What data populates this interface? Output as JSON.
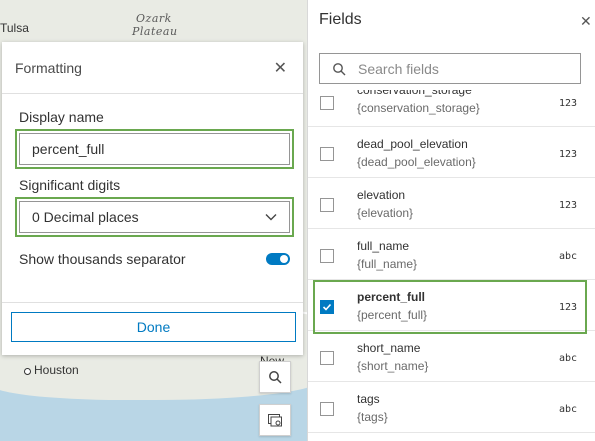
{
  "map": {
    "labels": {
      "tulsa": "Tulsa",
      "ozark": "Ozark",
      "plateau": "Plateau",
      "houston": "Houston",
      "new_orleans": "New Orle"
    }
  },
  "formatting": {
    "title": "Formatting",
    "display_name_label": "Display name",
    "display_name_value": "percent_full",
    "sig_digits_label": "Significant digits",
    "sig_digits_value": "0 Decimal places",
    "thousands_label": "Show thousands separator",
    "thousands_enabled": true,
    "done_label": "Done"
  },
  "fields": {
    "title": "Fields",
    "search_placeholder": "Search fields",
    "items": [
      {
        "name": "conservation_storage",
        "expr": "{conservation_storage}",
        "type": "123",
        "checked": false
      },
      {
        "name": "dead_pool_elevation",
        "expr": "{dead_pool_elevation}",
        "type": "123",
        "checked": false
      },
      {
        "name": "elevation",
        "expr": "{elevation}",
        "type": "123",
        "checked": false
      },
      {
        "name": "full_name",
        "expr": "{full_name}",
        "type": "abc",
        "checked": false
      },
      {
        "name": "percent_full",
        "expr": "{percent_full}",
        "type": "123",
        "checked": true
      },
      {
        "name": "short_name",
        "expr": "{short_name}",
        "type": "abc",
        "checked": false
      },
      {
        "name": "tags",
        "expr": "{tags}",
        "type": "abc",
        "checked": false
      }
    ]
  },
  "colors": {
    "accent": "#007ac2",
    "highlight": "#6aa84f"
  }
}
